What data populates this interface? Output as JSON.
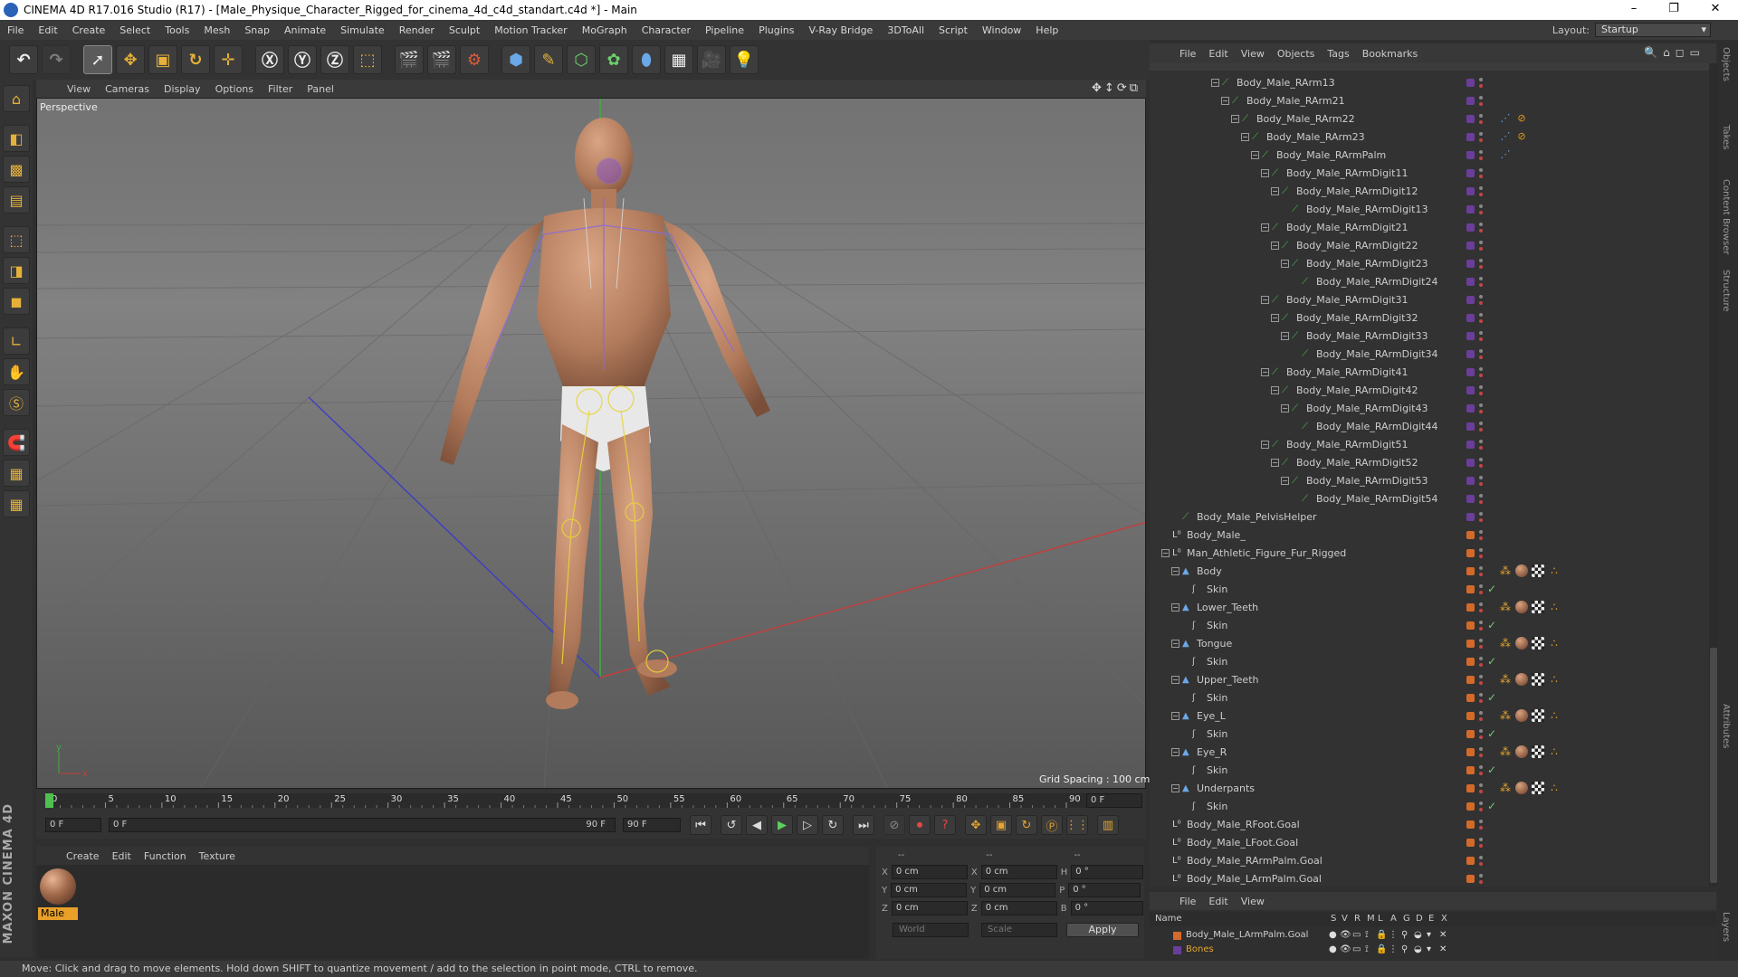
{
  "window": {
    "title": "CINEMA 4D R17.016 Studio (R17) - [Male_Physique_Character_Rigged_for_cinema_4d_c4d_standart.c4d *] - Main",
    "controls": [
      "–",
      "❐",
      "✕"
    ]
  },
  "menubar": {
    "items": [
      "File",
      "Edit",
      "Create",
      "Select",
      "Tools",
      "Mesh",
      "Snap",
      "Animate",
      "Simulate",
      "Render",
      "Sculpt",
      "Motion Tracker",
      "MoGraph",
      "Character",
      "Pipeline",
      "Plugins",
      "V-Ray Bridge",
      "3DToAll",
      "Script",
      "Window",
      "Help"
    ],
    "layout_label": "Layout:",
    "layout_value": "Startup"
  },
  "viewport": {
    "menu": [
      "View",
      "Cameras",
      "Display",
      "Options",
      "Filter",
      "Panel"
    ],
    "camera_label": "Perspective",
    "grid_spacing": "Grid Spacing : 100 cm",
    "axis_x": "x",
    "axis_y": "y"
  },
  "timeline": {
    "ticks": [
      "0",
      "5",
      "10",
      "15",
      "20",
      "25",
      "30",
      "35",
      "40",
      "45",
      "50",
      "55",
      "60",
      "65",
      "70",
      "75",
      "80",
      "85",
      "90"
    ],
    "current_frame": "0 F",
    "start_field": "0 F",
    "range_start": "0 F",
    "range_end": "90 F",
    "end_field": "90 F",
    "right_field": "0 F"
  },
  "material_manager": {
    "menu": [
      "Create",
      "Edit",
      "Function",
      "Texture"
    ],
    "materials": [
      {
        "name": "Male"
      }
    ]
  },
  "coordinates": {
    "header": [
      "--",
      "--",
      "--"
    ],
    "rows": [
      {
        "a_label": "X",
        "a_val": "0 cm",
        "b_label": "X",
        "b_val": "0 cm",
        "c_label": "H",
        "c_val": "0 °"
      },
      {
        "a_label": "Y",
        "a_val": "0 cm",
        "b_label": "Y",
        "b_val": "0 cm",
        "c_label": "P",
        "c_val": "0 °"
      },
      {
        "a_label": "Z",
        "a_val": "0 cm",
        "b_label": "Z",
        "b_val": "0 cm",
        "c_label": "B",
        "c_val": "0 °"
      }
    ],
    "mode_world": "World",
    "mode_scale": "Scale",
    "apply": "Apply"
  },
  "status": "Move: Click and drag to move elements. Hold down SHIFT to quantize movement / add to the selection in point mode, CTRL to remove.",
  "object_manager": {
    "menu": [
      "File",
      "Edit",
      "View",
      "Objects",
      "Tags",
      "Bookmarks"
    ],
    "rows": [
      {
        "name": "Body_Male_RArm13",
        "indent": 6,
        "kind": "bone",
        "color": "#6a3e9a",
        "exp": true
      },
      {
        "name": "Body_Male_RArm21",
        "indent": 7,
        "kind": "bone",
        "color": "#6a3e9a",
        "exp": true
      },
      {
        "name": "Body_Male_RArm22",
        "indent": 8,
        "kind": "bone",
        "color": "#6a3e9a",
        "exp": true,
        "tags": "bone-no"
      },
      {
        "name": "Body_Male_RArm23",
        "indent": 9,
        "kind": "bone",
        "color": "#6a3e9a",
        "exp": true,
        "tags": "bone-no"
      },
      {
        "name": "Body_Male_RArmPalm",
        "indent": 10,
        "kind": "bone",
        "color": "#6a3e9a",
        "exp": true,
        "tags": "bone"
      },
      {
        "name": "Body_Male_RArmDigit11",
        "indent": 11,
        "kind": "bone",
        "color": "#6a3e9a",
        "exp": true
      },
      {
        "name": "Body_Male_RArmDigit12",
        "indent": 12,
        "kind": "bone",
        "color": "#6a3e9a",
        "exp": true
      },
      {
        "name": "Body_Male_RArmDigit13",
        "indent": 13,
        "kind": "bone",
        "color": "#6a3e9a"
      },
      {
        "name": "Body_Male_RArmDigit21",
        "indent": 11,
        "kind": "bone",
        "color": "#6a3e9a",
        "exp": true
      },
      {
        "name": "Body_Male_RArmDigit22",
        "indent": 12,
        "kind": "bone",
        "color": "#6a3e9a",
        "exp": true
      },
      {
        "name": "Body_Male_RArmDigit23",
        "indent": 13,
        "kind": "bone",
        "color": "#6a3e9a",
        "exp": true
      },
      {
        "name": "Body_Male_RArmDigit24",
        "indent": 14,
        "kind": "bone",
        "color": "#6a3e9a"
      },
      {
        "name": "Body_Male_RArmDigit31",
        "indent": 11,
        "kind": "bone",
        "color": "#6a3e9a",
        "exp": true
      },
      {
        "name": "Body_Male_RArmDigit32",
        "indent": 12,
        "kind": "bone",
        "color": "#6a3e9a",
        "exp": true
      },
      {
        "name": "Body_Male_RArmDigit33",
        "indent": 13,
        "kind": "bone",
        "color": "#6a3e9a",
        "exp": true
      },
      {
        "name": "Body_Male_RArmDigit34",
        "indent": 14,
        "kind": "bone",
        "color": "#6a3e9a"
      },
      {
        "name": "Body_Male_RArmDigit41",
        "indent": 11,
        "kind": "bone",
        "color": "#6a3e9a",
        "exp": true
      },
      {
        "name": "Body_Male_RArmDigit42",
        "indent": 12,
        "kind": "bone",
        "color": "#6a3e9a",
        "exp": true
      },
      {
        "name": "Body_Male_RArmDigit43",
        "indent": 13,
        "kind": "bone",
        "color": "#6a3e9a",
        "exp": true
      },
      {
        "name": "Body_Male_RArmDigit44",
        "indent": 14,
        "kind": "bone",
        "color": "#6a3e9a"
      },
      {
        "name": "Body_Male_RArmDigit51",
        "indent": 11,
        "kind": "bone",
        "color": "#6a3e9a",
        "exp": true
      },
      {
        "name": "Body_Male_RArmDigit52",
        "indent": 12,
        "kind": "bone",
        "color": "#6a3e9a",
        "exp": true
      },
      {
        "name": "Body_Male_RArmDigit53",
        "indent": 13,
        "kind": "bone",
        "color": "#6a3e9a",
        "exp": true
      },
      {
        "name": "Body_Male_RArmDigit54",
        "indent": 14,
        "kind": "bone",
        "color": "#6a3e9a"
      },
      {
        "name": "Body_Male_PelvisHelper",
        "indent": 2,
        "kind": "bone",
        "color": "#6a3e9a"
      },
      {
        "name": "Body_Male_",
        "indent": 1,
        "kind": "null",
        "color": "#d46a2a"
      },
      {
        "name": "Man_Athletic_Figure_Fur_Rigged",
        "indent": 1,
        "kind": "null",
        "color": "#d46a2a",
        "exp": true
      },
      {
        "name": "Body",
        "indent": 2,
        "kind": "poly",
        "color": "#d46a2a",
        "exp": true,
        "tags": "mat"
      },
      {
        "name": "Skin",
        "indent": 3,
        "kind": "skin",
        "color": "#d46a2a",
        "check": true
      },
      {
        "name": "Lower_Teeth",
        "indent": 2,
        "kind": "poly",
        "color": "#d46a2a",
        "exp": true,
        "tags": "mat"
      },
      {
        "name": "Skin",
        "indent": 3,
        "kind": "skin",
        "color": "#d46a2a",
        "check": true
      },
      {
        "name": "Tongue",
        "indent": 2,
        "kind": "poly",
        "color": "#d46a2a",
        "exp": true,
        "tags": "mat"
      },
      {
        "name": "Skin",
        "indent": 3,
        "kind": "skin",
        "color": "#d46a2a",
        "check": true
      },
      {
        "name": "Upper_Teeth",
        "indent": 2,
        "kind": "poly",
        "color": "#d46a2a",
        "exp": true,
        "tags": "mat"
      },
      {
        "name": "Skin",
        "indent": 3,
        "kind": "skin",
        "color": "#d46a2a",
        "check": true
      },
      {
        "name": "Eye_L",
        "indent": 2,
        "kind": "poly",
        "color": "#d46a2a",
        "exp": true,
        "tags": "mat"
      },
      {
        "name": "Skin",
        "indent": 3,
        "kind": "skin",
        "color": "#d46a2a",
        "check": true
      },
      {
        "name": "Eye_R",
        "indent": 2,
        "kind": "poly",
        "color": "#d46a2a",
        "exp": true,
        "tags": "mat"
      },
      {
        "name": "Skin",
        "indent": 3,
        "kind": "skin",
        "color": "#d46a2a",
        "check": true
      },
      {
        "name": "Underpants",
        "indent": 2,
        "kind": "poly",
        "color": "#d46a2a",
        "exp": true,
        "tags": "mat"
      },
      {
        "name": "Skin",
        "indent": 3,
        "kind": "skin",
        "color": "#d46a2a",
        "check": true
      },
      {
        "name": "Body_Male_RFoot.Goal",
        "indent": 1,
        "kind": "null",
        "color": "#d46a2a"
      },
      {
        "name": "Body_Male_LFoot.Goal",
        "indent": 1,
        "kind": "null",
        "color": "#d46a2a"
      },
      {
        "name": "Body_Male_RArmPalm.Goal",
        "indent": 1,
        "kind": "null",
        "color": "#d46a2a"
      },
      {
        "name": "Body_Male_LArmPalm.Goal",
        "indent": 1,
        "kind": "null",
        "color": "#d46a2a"
      }
    ]
  },
  "layer_manager": {
    "menu": [
      "File",
      "Edit",
      "View"
    ],
    "columns": [
      "Name",
      "S",
      "V",
      "R",
      "M",
      "L",
      "A",
      "G",
      "D",
      "E",
      "X"
    ],
    "layers": [
      {
        "name": "Body_Male_LArmPalm.Goal",
        "color": "#d46a2a",
        "text_color": "#d0d0d0"
      },
      {
        "name": "Bones",
        "color": "#6a3e9a",
        "text_color": "#e5a530"
      }
    ]
  },
  "side_tabs": [
    "Objects",
    "Takes",
    "Content Browser",
    "Structure",
    "Attributes",
    "Layers"
  ],
  "colors": {
    "accent": "#e5b13a",
    "material_selected": "#e8a028",
    "axis_x": "#c04040",
    "axis_y": "#3fae3f",
    "axis_z": "#4040c0"
  }
}
